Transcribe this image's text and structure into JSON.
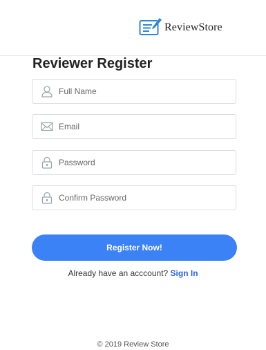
{
  "brand": {
    "name": "ReviewStore"
  },
  "form": {
    "title": "Reviewer Register",
    "fields": {
      "full_name": {
        "placeholder": "Full Name",
        "icon": "user-icon"
      },
      "email": {
        "placeholder": "Email",
        "icon": "envelope-icon"
      },
      "password": {
        "placeholder": "Password",
        "icon": "lock-icon"
      },
      "confirm_password": {
        "placeholder": "Confirm Password",
        "icon": "lock-icon"
      }
    },
    "submit_label": "Register Now!",
    "signin_prompt": "Already have an acccount?",
    "signin_link": "Sign In"
  },
  "footer": {
    "text": "© 2019 Review Store"
  },
  "colors": {
    "accent": "#3b82f6",
    "link": "#2563eb",
    "icon": "#9ca3af"
  }
}
